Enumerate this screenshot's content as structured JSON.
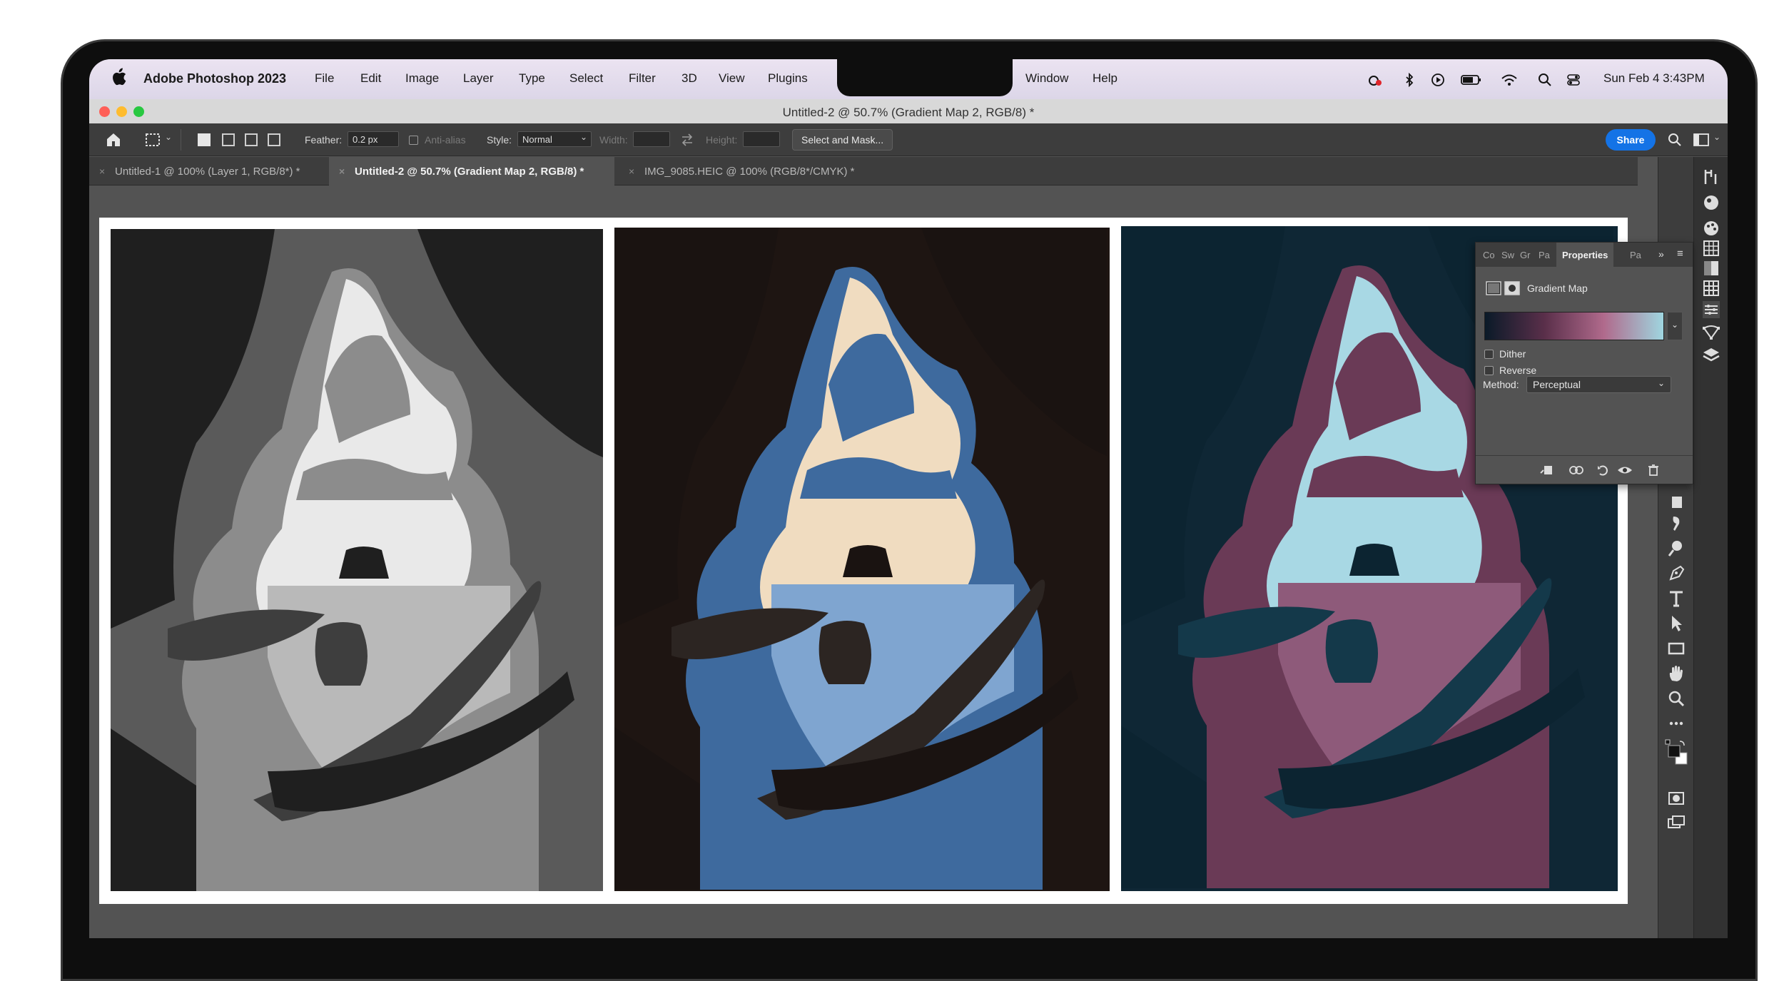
{
  "menubar": {
    "app_name": "Adobe Photoshop 2023",
    "items": [
      "File",
      "Edit",
      "Image",
      "Layer",
      "Type",
      "Select",
      "Filter",
      "3D",
      "View",
      "Plugins"
    ],
    "window": "Window",
    "help": "Help",
    "clock": "Sun Feb 4  3:43PM"
  },
  "title": {
    "document": "Untitled-2 @ 50.7% (Gradient Map 2, RGB/8) *"
  },
  "options": {
    "feather_label": "Feather:",
    "feather_value": "0.2 px",
    "antialias_label": "Anti-alias",
    "style_label": "Style:",
    "style_value": "Normal",
    "width_label": "Width:",
    "height_label": "Height:",
    "select_mask": "Select and Mask...",
    "share": "Share"
  },
  "tabs": [
    {
      "label": "Untitled-1 @ 100% (Layer 1, RGB/8*) *",
      "active": false
    },
    {
      "label": "Untitled-2 @ 50.7% (Gradient Map 2, RGB/8) *",
      "active": true
    },
    {
      "label": "IMG_9085.HEIC @ 100% (RGB/8*/CMYK) *",
      "active": false
    }
  ],
  "properties": {
    "tabs": [
      "Co",
      "Sw",
      "Gr",
      "Pa",
      "Properties",
      "Pa"
    ],
    "active_tab": "Properties",
    "adjustment": "Gradient Map",
    "dither": "Dither",
    "dither_checked": false,
    "reverse": "Reverse",
    "reverse_checked": false,
    "method_label": "Method:",
    "method_value": "Perceptual",
    "gradient_colors": [
      "#0a1a28",
      "#5a2f4a",
      "#b06a8c",
      "#9fd6e0"
    ]
  },
  "artwork": {
    "panels": [
      "grayscale",
      "blue",
      "teal-magenta"
    ]
  }
}
